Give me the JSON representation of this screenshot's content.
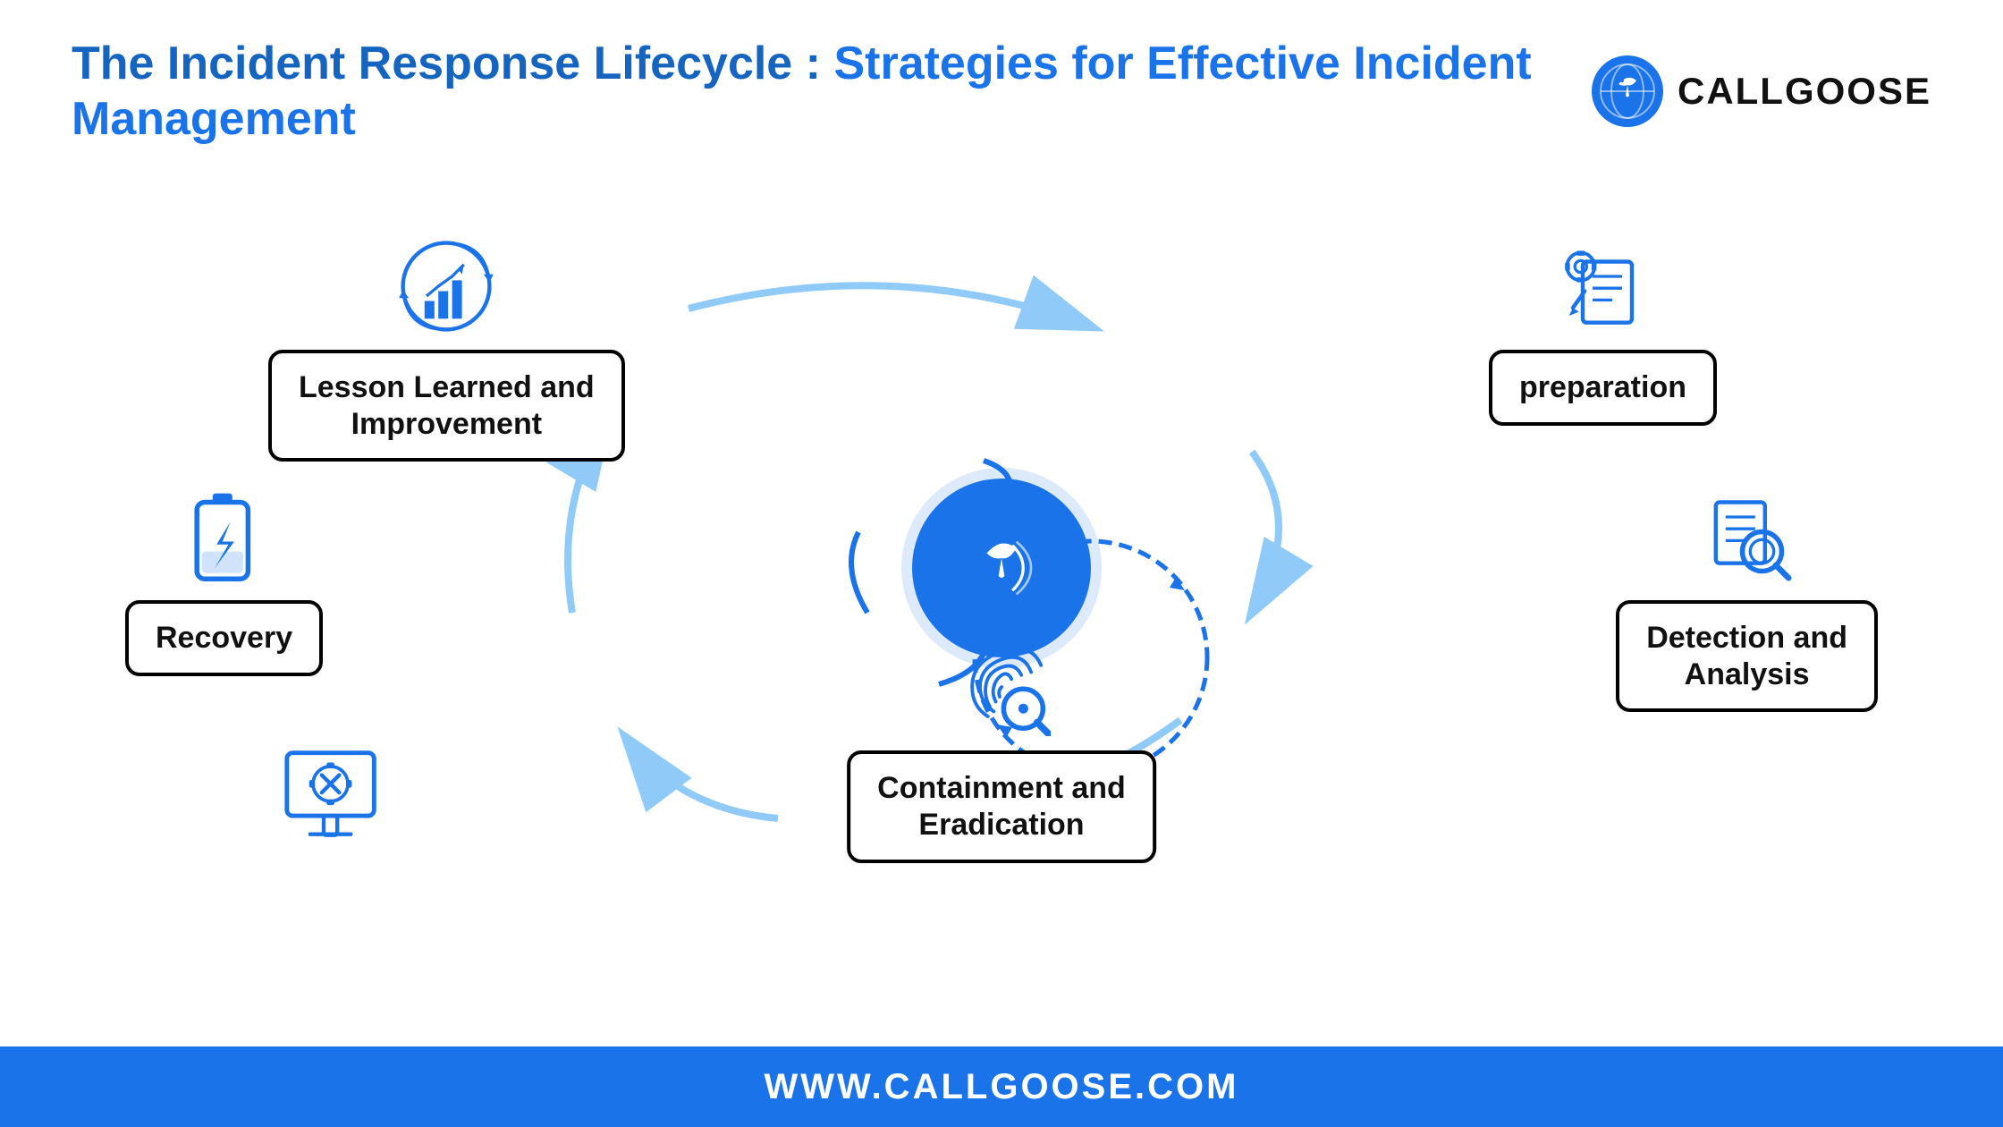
{
  "header": {
    "title_prefix": "The Incident Response Lifecycle : ",
    "title_highlight": "Strategies for Effective Incident Management"
  },
  "logo": {
    "text": "CALLGOOSE"
  },
  "nodes": {
    "lesson": {
      "label_line1": "Lesson Learned and",
      "label_line2": "Improvement"
    },
    "preparation": {
      "label": "preparation"
    },
    "detection": {
      "label_line1": "Detection and",
      "label_line2": "Analysis"
    },
    "containment": {
      "label_line1": "Containment and",
      "label_line2": "Eradication"
    },
    "recovery": {
      "label": "Recovery"
    }
  },
  "footer": {
    "url": "WWW.CALLGOOSE.COM"
  },
  "colors": {
    "primary_blue": "#1a73e8",
    "light_blue": "#90CAF9",
    "dark_text": "#111111",
    "white": "#ffffff"
  }
}
